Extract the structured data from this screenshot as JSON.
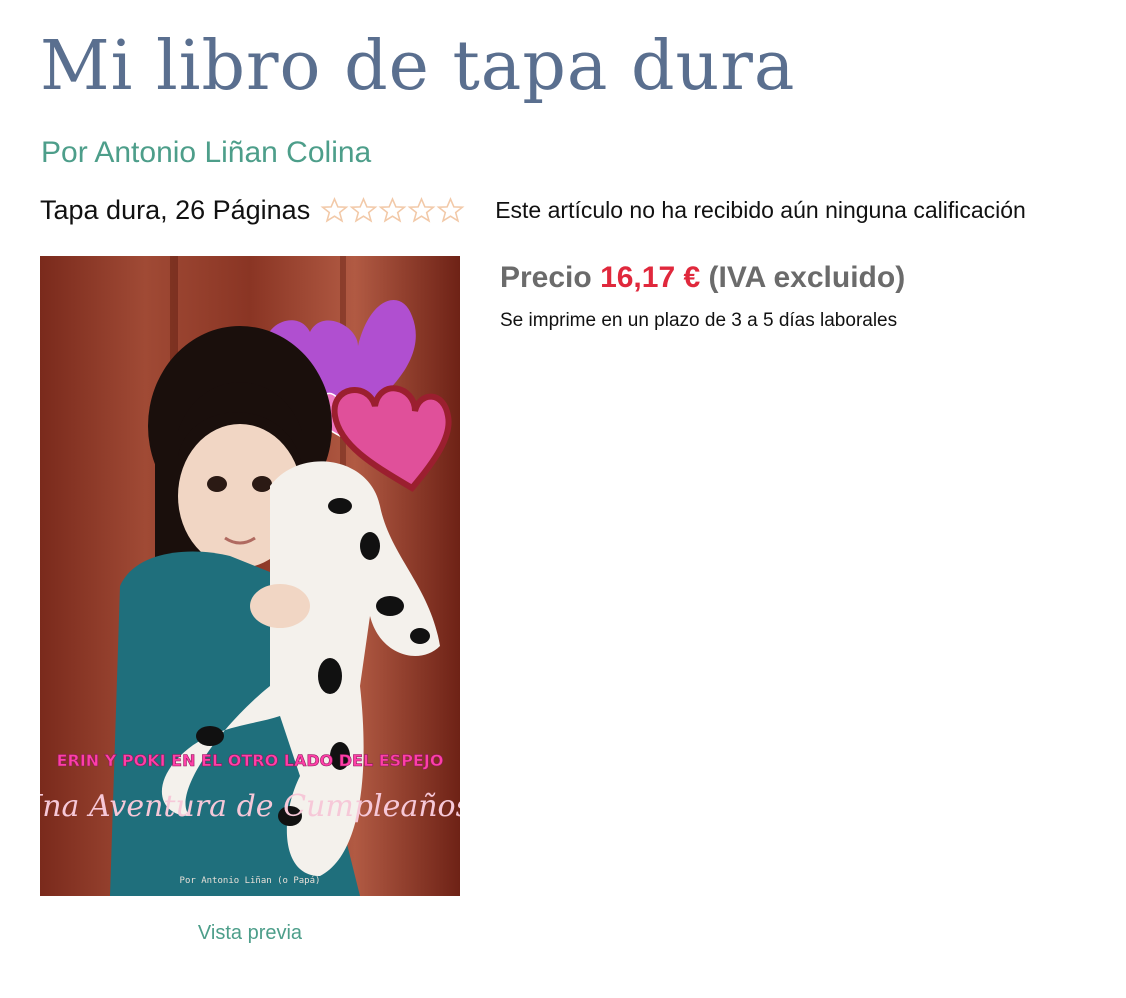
{
  "product": {
    "title": "Mi libro de tapa dura",
    "author": "Por Antonio Liñan Colina",
    "format": "Tapa dura, 26 Páginas",
    "rating": {
      "value": 0,
      "max": 5
    },
    "rating_note": "Este artículo no ha recibido aún ninguna calificación"
  },
  "pricing": {
    "label": "Precio",
    "value": "16,17 €",
    "tax_note": "(IVA excluido)",
    "shipping_note": "Se imprime en un plazo de 3 a 5 días laborales"
  },
  "cover": {
    "title_line": "ERIN Y POKI EN EL OTRO LADO DEL ESPEJO",
    "subtitle": "Una Aventura de Cumpleaños!",
    "credit": "Por Antonio Liñan (o Papá)"
  },
  "preview_label": "Vista previa",
  "colors": {
    "title": "#5a6f8f",
    "link": "#4d9e8a",
    "price": "#e0283c",
    "star_outline": "#f2c9a8"
  }
}
